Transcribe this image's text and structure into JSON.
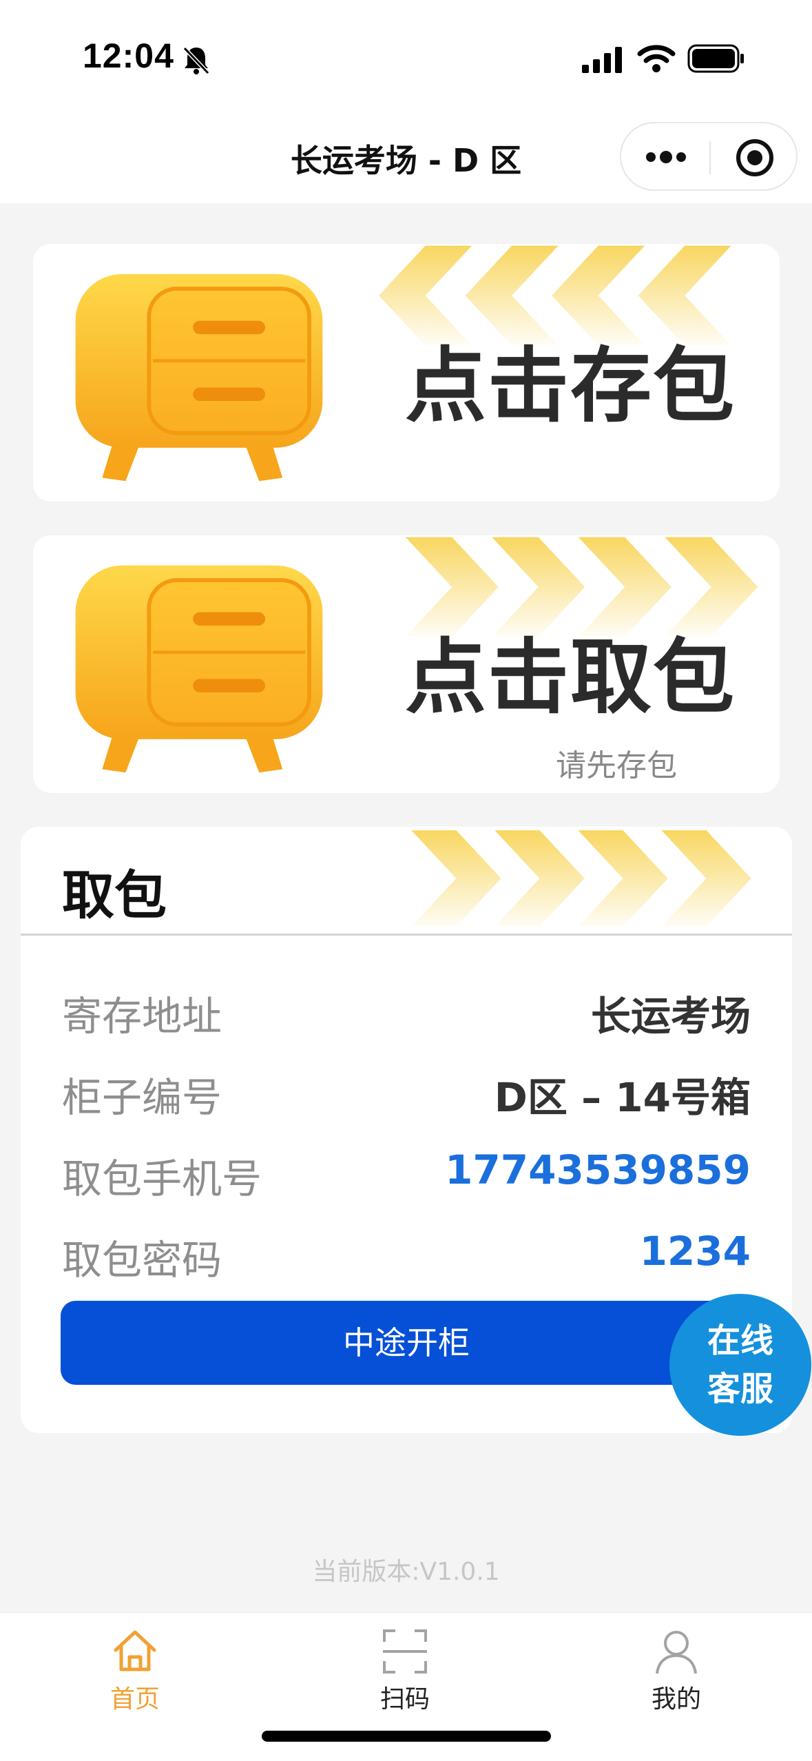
{
  "status_bar": {
    "time": "12:04",
    "icons": [
      "bell-off-icon",
      "signal-icon",
      "wifi-icon",
      "battery-icon"
    ]
  },
  "nav": {
    "title": "长运考场 - D 区",
    "capsule_icons": [
      "more-icon",
      "target-icon"
    ]
  },
  "cards": {
    "store": {
      "label": "点击存包",
      "icon": "cabinet-icon"
    },
    "pick": {
      "label": "点击取包",
      "subtext": "请先存包",
      "icon": "cabinet-icon"
    }
  },
  "pickup": {
    "title": "取包",
    "rows": [
      {
        "label": "寄存地址",
        "value": "长运考场"
      },
      {
        "label": "柜子编号",
        "value": "D区 – 14号箱"
      },
      {
        "label": "取包手机号",
        "value": "17743539859"
      },
      {
        "label": "取包密码",
        "value": "1234"
      }
    ],
    "button": "中途开柜"
  },
  "service": {
    "line1": "在线",
    "line2": "客服"
  },
  "version": "当前版本:V1.0.1",
  "tabs": [
    {
      "label": "首页",
      "icon": "home-icon",
      "active": true
    },
    {
      "label": "扫码",
      "icon": "scan-icon",
      "active": false
    },
    {
      "label": "我的",
      "icon": "user-icon",
      "active": false
    }
  ],
  "colors": {
    "accent_yellow": "#f7c331",
    "button_blue": "#0550d6",
    "value_blue": "#1a6fdc",
    "service_blue": "#1590dc",
    "tab_active": "#f1a132"
  }
}
